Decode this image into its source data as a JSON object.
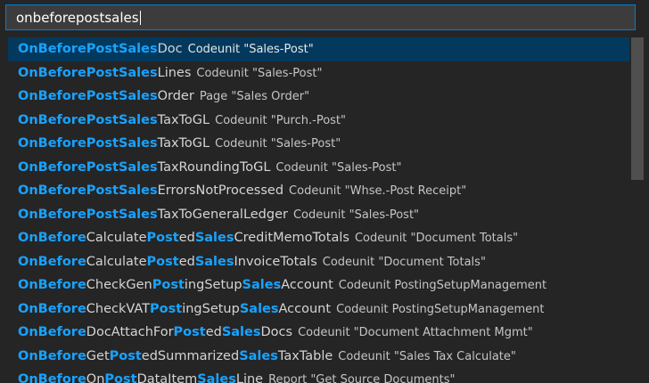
{
  "search": {
    "value": "onbeforepostsales"
  },
  "suggestions": [
    {
      "parts": [
        {
          "t": "OnBeforePostSales",
          "h": true
        },
        {
          "t": "Doc",
          "h": false
        }
      ],
      "detail": "Codeunit \"Sales-Post\"",
      "selected": true
    },
    {
      "parts": [
        {
          "t": "OnBeforePostSales",
          "h": true
        },
        {
          "t": "Lines",
          "h": false
        }
      ],
      "detail": "Codeunit \"Sales-Post\""
    },
    {
      "parts": [
        {
          "t": "OnBeforePostSales",
          "h": true
        },
        {
          "t": "Order",
          "h": false
        }
      ],
      "detail": "Page \"Sales Order\""
    },
    {
      "parts": [
        {
          "t": "OnBeforePostSales",
          "h": true
        },
        {
          "t": "TaxToGL",
          "h": false
        }
      ],
      "detail": "Codeunit \"Purch.-Post\""
    },
    {
      "parts": [
        {
          "t": "OnBeforePostSales",
          "h": true
        },
        {
          "t": "TaxToGL",
          "h": false
        }
      ],
      "detail": "Codeunit \"Sales-Post\""
    },
    {
      "parts": [
        {
          "t": "OnBeforePostSales",
          "h": true
        },
        {
          "t": "TaxRoundingToGL",
          "h": false
        }
      ],
      "detail": "Codeunit \"Sales-Post\""
    },
    {
      "parts": [
        {
          "t": "OnBeforePostSales",
          "h": true
        },
        {
          "t": "ErrorsNotProcessed",
          "h": false
        }
      ],
      "detail": "Codeunit \"Whse.-Post Receipt\""
    },
    {
      "parts": [
        {
          "t": "OnBeforePostSales",
          "h": true
        },
        {
          "t": "TaxToGeneralLedger",
          "h": false
        }
      ],
      "detail": "Codeunit \"Sales-Post\""
    },
    {
      "parts": [
        {
          "t": "OnBefore",
          "h": true
        },
        {
          "t": "Calculate",
          "h": false
        },
        {
          "t": "Post",
          "h": true
        },
        {
          "t": "ed",
          "h": false
        },
        {
          "t": "Sales",
          "h": true
        },
        {
          "t": "CreditMemoTotals",
          "h": false
        }
      ],
      "detail": "Codeunit \"Document Totals\""
    },
    {
      "parts": [
        {
          "t": "OnBefore",
          "h": true
        },
        {
          "t": "Calculate",
          "h": false
        },
        {
          "t": "Post",
          "h": true
        },
        {
          "t": "ed",
          "h": false
        },
        {
          "t": "Sales",
          "h": true
        },
        {
          "t": "InvoiceTotals",
          "h": false
        }
      ],
      "detail": "Codeunit \"Document Totals\""
    },
    {
      "parts": [
        {
          "t": "OnBefore",
          "h": true
        },
        {
          "t": "CheckGen",
          "h": false
        },
        {
          "t": "Post",
          "h": true
        },
        {
          "t": "ingSetup",
          "h": false
        },
        {
          "t": "Sales",
          "h": true
        },
        {
          "t": "Account",
          "h": false
        }
      ],
      "detail": "Codeunit PostingSetupManagement"
    },
    {
      "parts": [
        {
          "t": "OnBefore",
          "h": true
        },
        {
          "t": "CheckVAT",
          "h": false
        },
        {
          "t": "Post",
          "h": true
        },
        {
          "t": "ingSetup",
          "h": false
        },
        {
          "t": "Sales",
          "h": true
        },
        {
          "t": "Account",
          "h": false
        }
      ],
      "detail": "Codeunit PostingSetupManagement"
    },
    {
      "parts": [
        {
          "t": "OnBefore",
          "h": true
        },
        {
          "t": "DocAttachFor",
          "h": false
        },
        {
          "t": "Post",
          "h": true
        },
        {
          "t": "ed",
          "h": false
        },
        {
          "t": "Sales",
          "h": true
        },
        {
          "t": "Docs",
          "h": false
        }
      ],
      "detail": "Codeunit \"Document Attachment Mgmt\""
    },
    {
      "parts": [
        {
          "t": "OnBefore",
          "h": true
        },
        {
          "t": "Get",
          "h": false
        },
        {
          "t": "Post",
          "h": true
        },
        {
          "t": "edSummarized",
          "h": false
        },
        {
          "t": "Sales",
          "h": true
        },
        {
          "t": "TaxTable",
          "h": false
        }
      ],
      "detail": "Codeunit \"Sales Tax Calculate\""
    },
    {
      "parts": [
        {
          "t": "OnBefore",
          "h": true
        },
        {
          "t": "On",
          "h": false
        },
        {
          "t": "Post",
          "h": true
        },
        {
          "t": "DataItem",
          "h": false
        },
        {
          "t": "Sales",
          "h": true
        },
        {
          "t": "Line",
          "h": false
        }
      ],
      "detail": "Report \"Get Source Documents\""
    }
  ],
  "colors": {
    "highlight": "#18a3ff",
    "selected_bg": "#04395e",
    "focus_border": "#007fd4"
  }
}
